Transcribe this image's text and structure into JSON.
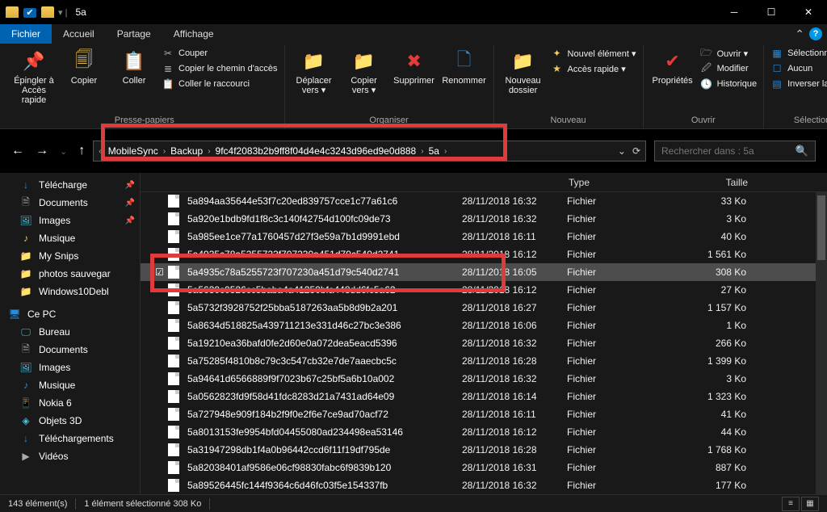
{
  "window": {
    "title": "5a"
  },
  "tabs": {
    "file": "Fichier",
    "home": "Accueil",
    "share": "Partage",
    "view": "Affichage"
  },
  "ribbon": {
    "clipboard": {
      "label": "Presse-papiers",
      "pin": "Épingler à\nAccès rapide",
      "copy": "Copier",
      "paste": "Coller",
      "cut": "Couper",
      "copypath": "Copier le chemin d'accès",
      "paste_shortcut": "Coller le raccourci"
    },
    "organize": {
      "label": "Organiser",
      "move": "Déplacer\nvers ▾",
      "copyto": "Copier\nvers ▾",
      "delete": "Supprimer",
      "rename": "Renommer"
    },
    "new": {
      "label": "Nouveau",
      "newfolder": "Nouveau\ndossier",
      "newitem": "Nouvel élément ▾",
      "quickaccess": "Accès rapide ▾"
    },
    "open": {
      "label": "Ouvrir",
      "properties": "Propriétés",
      "open": "Ouvrir ▾",
      "edit": "Modifier",
      "history": "Historique"
    },
    "select": {
      "label": "Sélectionner",
      "all": "Sélectionner tout",
      "none": "Aucun",
      "invert": "Inverser la sélection"
    }
  },
  "breadcrumb": [
    "MobileSync",
    "Backup",
    "9fc4f2083b2b9ff8f04d4e4c3243d96ed9e0d888",
    "5a"
  ],
  "search": {
    "placeholder": "Rechercher dans : 5a"
  },
  "columns": {
    "name": "",
    "date": "",
    "type": "Type",
    "size": "Taille"
  },
  "sidebar": {
    "quick": [
      {
        "label": "Télécharge",
        "icon": "↓",
        "cls": "blue",
        "pin": true
      },
      {
        "label": "Documents",
        "icon": "🗎",
        "cls": "grey",
        "pin": true
      },
      {
        "label": "Images",
        "icon": "🖼",
        "cls": "cyan",
        "pin": true
      },
      {
        "label": "Musique",
        "icon": "♪",
        "cls": "yellow",
        "pin": false
      },
      {
        "label": "My Snips",
        "icon": "📁",
        "cls": "yellow",
        "pin": false
      },
      {
        "label": "photos sauvegar",
        "icon": "📁",
        "cls": "yellow",
        "pin": false
      },
      {
        "label": "Windows10Debl",
        "icon": "📁",
        "cls": "yellow",
        "pin": false
      }
    ],
    "pc_label": "Ce PC",
    "pc": [
      {
        "label": "Bureau",
        "icon": "🖵",
        "cls": "cyan"
      },
      {
        "label": "Documents",
        "icon": "🗎",
        "cls": "grey"
      },
      {
        "label": "Images",
        "icon": "🖼",
        "cls": "cyan"
      },
      {
        "label": "Musique",
        "icon": "♪",
        "cls": "blue"
      },
      {
        "label": "Nokia 6",
        "icon": "📱",
        "cls": "grey"
      },
      {
        "label": "Objets 3D",
        "icon": "◈",
        "cls": "cyan"
      },
      {
        "label": "Téléchargements",
        "icon": "↓",
        "cls": "blue"
      },
      {
        "label": "Vidéos",
        "icon": "▶",
        "cls": "grey"
      }
    ]
  },
  "files": [
    {
      "name": "5a894aa35644e53f7c20ed839757cce1c77a61c6",
      "date": "28/11/2018 16:32",
      "type": "Fichier",
      "size": "33 Ko"
    },
    {
      "name": "5a920e1bdb9fd1f8c3c140f42754d100fc09de73",
      "date": "28/11/2018 16:32",
      "type": "Fichier",
      "size": "3 Ko"
    },
    {
      "name": "5a985ee1ce77a1760457d27f3e59a7b1d9991ebd",
      "date": "28/11/2018 16:11",
      "type": "Fichier",
      "size": "40 Ko"
    },
    {
      "name": "5a4935c78a5255723f707230a451d79c540d2741",
      "date": "28/11/2018 16:12",
      "type": "Fichier",
      "size": "1 561 Ko"
    },
    {
      "name": "5a4935c78a5255723f707230a451d79c540d2741",
      "date": "28/11/2018 16:05",
      "type": "Fichier",
      "size": "308 Ko",
      "selected": true,
      "checked": true
    },
    {
      "name": "5a5630c0526cc5baba4a41250bfa448dd6fc5a62",
      "date": "28/11/2018 16:12",
      "type": "Fichier",
      "size": "27 Ko"
    },
    {
      "name": "5a5732f3928752f25bba5187263aa5b8d9b2a201",
      "date": "28/11/2018 16:27",
      "type": "Fichier",
      "size": "1 157 Ko"
    },
    {
      "name": "5a8634d518825a439711213e331d46c27bc3e386",
      "date": "28/11/2018 16:06",
      "type": "Fichier",
      "size": "1 Ko"
    },
    {
      "name": "5a19210ea36bafd0fe2d60e0a072dea5eacd5396",
      "date": "28/11/2018 16:32",
      "type": "Fichier",
      "size": "266 Ko"
    },
    {
      "name": "5a75285f4810b8c79c3c547cb32e7de7aaecbc5c",
      "date": "28/11/2018 16:28",
      "type": "Fichier",
      "size": "1 399 Ko"
    },
    {
      "name": "5a94641d6566889f9f7023b67c25bf5a6b10a002",
      "date": "28/11/2018 16:32",
      "type": "Fichier",
      "size": "3 Ko"
    },
    {
      "name": "5a0562823fd9f58d41fdc8283d21a7431ad64e09",
      "date": "28/11/2018 16:14",
      "type": "Fichier",
      "size": "1 323 Ko"
    },
    {
      "name": "5a727948e909f184b2f9f0e2f6e7ce9ad70acf72",
      "date": "28/11/2018 16:11",
      "type": "Fichier",
      "size": "41 Ko"
    },
    {
      "name": "5a8013153fe9954bfd04455080ad234498ea53146",
      "date": "28/11/2018 16:12",
      "type": "Fichier",
      "size": "44 Ko"
    },
    {
      "name": "5a31947298db1f4a0b96442ccd6f11f19df795de",
      "date": "28/11/2018 16:28",
      "type": "Fichier",
      "size": "1 768 Ko"
    },
    {
      "name": "5a82038401af9586e06cf98830fabc6f9839b120",
      "date": "28/11/2018 16:31",
      "type": "Fichier",
      "size": "887 Ko"
    },
    {
      "name": "5a89526445fc144f9364c6d46fc03f5e154337fb",
      "date": "28/11/2018 16:32",
      "type": "Fichier",
      "size": "177 Ko"
    }
  ],
  "status": {
    "count": "143 élément(s)",
    "selection": "1 élément sélectionné  308 Ko"
  }
}
